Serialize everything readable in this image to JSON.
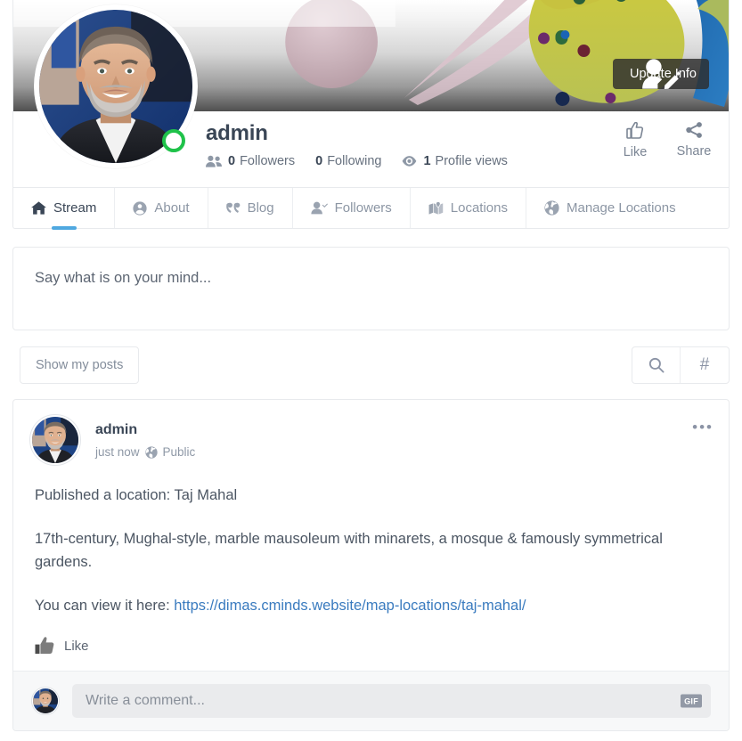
{
  "cover": {
    "update_info_label": "Update Info",
    "update_info_icon": "user-edit-icon",
    "gradient_top": "#ffffff",
    "gradient_bottom": "#4f4f4f",
    "accent_shapes": [
      "#c9c24a",
      "#d7cf55",
      "#1f6fb5",
      "#2e6b3d",
      "#d9bcc8",
      "#1b2f5e",
      "#6b2a6b"
    ]
  },
  "profile": {
    "name": "admin",
    "avatar_icon": "user-avatar",
    "status": "online",
    "status_color": "#1fc24a",
    "stats": [
      {
        "icon": "users-icon",
        "count": "0",
        "label": "Followers"
      },
      {
        "icon": "",
        "count": "0",
        "label": "Following"
      },
      {
        "icon": "eye-icon",
        "count": "1",
        "label": "Profile views"
      }
    ],
    "actions": [
      {
        "icon": "thumbs-up-icon",
        "label": "Like"
      },
      {
        "icon": "share-icon",
        "label": "Share"
      }
    ]
  },
  "tabs": [
    {
      "icon": "home-icon",
      "label": "Stream",
      "active": true
    },
    {
      "icon": "user-circle-icon",
      "label": "About",
      "active": false
    },
    {
      "icon": "quote-icon",
      "label": "Blog",
      "active": false
    },
    {
      "icon": "user-check-icon",
      "label": "Followers",
      "active": false
    },
    {
      "icon": "map-marker-icon",
      "label": "Locations",
      "active": false
    },
    {
      "icon": "globe-icon",
      "label": "Manage Locations",
      "active": false
    }
  ],
  "composer": {
    "placeholder": "Say what is on your mind..."
  },
  "filters": {
    "show_my_posts_label": "Show my posts",
    "search_icon": "search-icon",
    "hashtag_icon": "hashtag-icon",
    "hashtag_glyph": "#"
  },
  "post": {
    "author": "admin",
    "timestamp": "just now",
    "privacy": "Public",
    "privacy_icon": "globe-icon",
    "menu_glyph": "•••",
    "paragraphs": [
      "Published a location: Taj Mahal",
      "17th-century, Mughal-style, marble mausoleum with minarets, a mosque & famously symmetrical gardens."
    ],
    "link_prefix": "You can view it here: ",
    "link_text": "https://dimas.cminds.website/map-locations/taj-mahal/",
    "like_label": "Like",
    "like_icon": "thumbs-up-icon",
    "comment_placeholder": "Write a comment...",
    "gif_badge_label": "GIF",
    "link_color": "#3a7bbf"
  }
}
